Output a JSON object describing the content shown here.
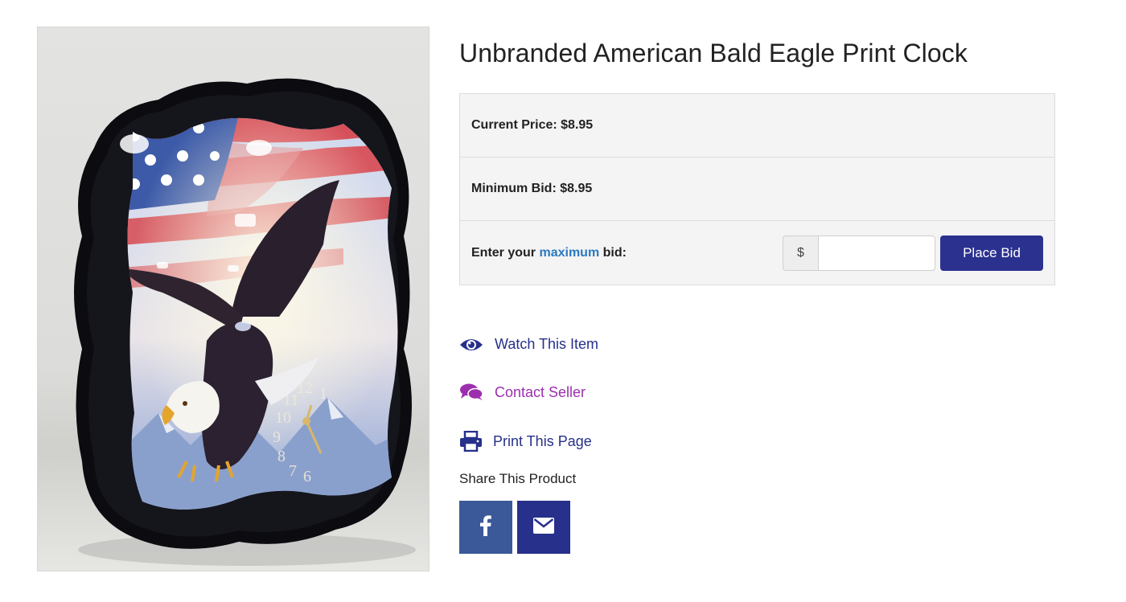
{
  "product": {
    "title": "Unbranded American Bald Eagle Print Clock",
    "image_alt": "Unbranded American Bald Eagle Print Clock"
  },
  "bidding": {
    "current_price": "Current Price: $8.95",
    "minimum_bid": "Minimum Bid: $8.95",
    "enter_prefix": "Enter your ",
    "enter_highlight": "maximum",
    "enter_suffix": " bid:",
    "currency_symbol": "$",
    "bid_value": "",
    "place_bid_label": "Place Bid"
  },
  "actions": {
    "watch": {
      "label": "Watch This Item",
      "icon": "eye-icon"
    },
    "contact": {
      "label": "Contact Seller",
      "icon": "comments-icon"
    },
    "print": {
      "label": "Print This Page",
      "icon": "printer-icon"
    }
  },
  "share": {
    "label": "Share This Product",
    "buttons": [
      {
        "icon": "facebook-icon",
        "color": "#3b5998"
      },
      {
        "icon": "envelope-icon",
        "color": "#27308a"
      }
    ]
  },
  "colors": {
    "primary": "#27308a",
    "contact": "#9b2fae",
    "highlight": "#2b79c2",
    "panel_bg": "#f4f4f4"
  }
}
